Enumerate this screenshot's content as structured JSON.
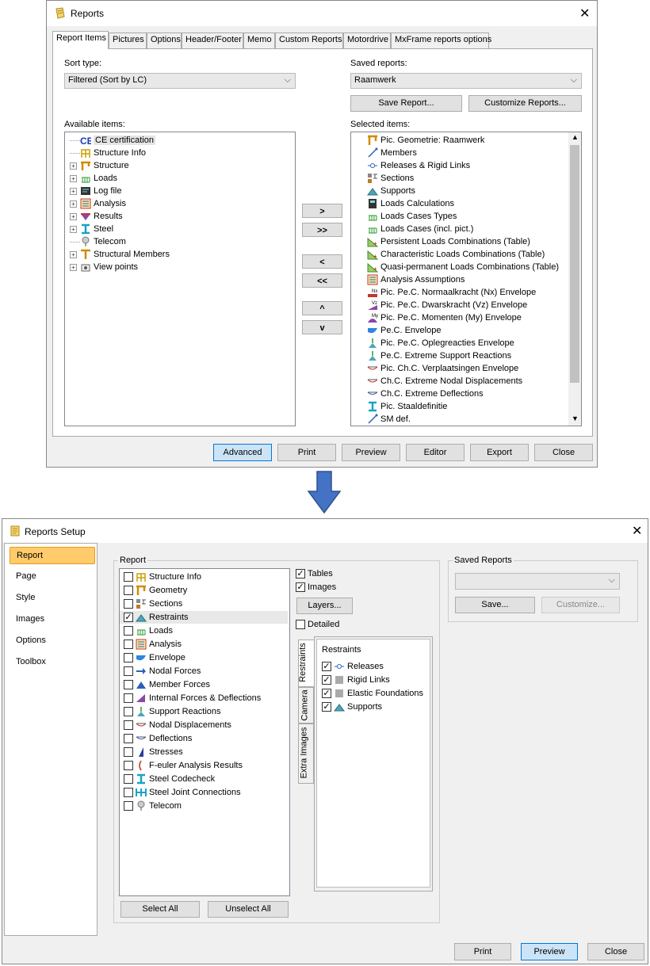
{
  "reports_dialog": {
    "title": "Reports",
    "tabs": [
      "Report Items",
      "Pictures",
      "Options",
      "Header/Footer",
      "Memo",
      "Custom Reports",
      "Motordrive",
      "MxFrame reports options"
    ],
    "sort_type_label": "Sort type:",
    "sort_type_value": "Filtered (Sort by LC)",
    "saved_reports_label": "Saved reports:",
    "saved_reports_value": "Raamwerk",
    "save_report_label": "Save Report...",
    "customize_reports_label": "Customize Reports...",
    "available_label": "Available items:",
    "available_items": [
      {
        "label": "CE certification",
        "icon": "ce-icon",
        "expandable": false,
        "selected": true
      },
      {
        "label": "Structure Info",
        "icon": "structure-info-icon",
        "expandable": false
      },
      {
        "label": "Structure",
        "icon": "structure-icon",
        "expandable": true
      },
      {
        "label": "Loads",
        "icon": "loads-icon",
        "expandable": true
      },
      {
        "label": "Log file",
        "icon": "log-file-icon",
        "expandable": true
      },
      {
        "label": "Analysis",
        "icon": "analysis-icon",
        "expandable": true
      },
      {
        "label": "Results",
        "icon": "results-icon",
        "expandable": true
      },
      {
        "label": "Steel",
        "icon": "steel-icon",
        "expandable": true
      },
      {
        "label": "Telecom",
        "icon": "telecom-icon",
        "expandable": false
      },
      {
        "label": "Structural Members",
        "icon": "structural-members-icon",
        "expandable": true
      },
      {
        "label": "View points",
        "icon": "view-points-icon",
        "expandable": true
      }
    ],
    "move_buttons": [
      ">",
      ">>",
      "<",
      "<<",
      "^",
      "v"
    ],
    "selected_label": "Selected items:",
    "selected_items": [
      {
        "label": "Pic. Geometrie: Raamwerk",
        "icon": "geometry-icon"
      },
      {
        "label": "Members",
        "icon": "members-icon"
      },
      {
        "label": "Releases & Rigid Links",
        "icon": "releases-icon"
      },
      {
        "label": "Sections",
        "icon": "sections-icon"
      },
      {
        "label": "Supports",
        "icon": "supports-icon"
      },
      {
        "label": "Loads Calculations",
        "icon": "loads-calculations-icon"
      },
      {
        "label": "Loads Cases Types",
        "icon": "load-cases-icon"
      },
      {
        "label": "Loads Cases (incl. pict.)",
        "icon": "load-cases-icon"
      },
      {
        "label": "Persistent Loads Combinations (Table)",
        "icon": "combination-icon"
      },
      {
        "label": "Characteristic Loads Combinations (Table)",
        "icon": "combination-icon"
      },
      {
        "label": "Quasi-permanent Loads Combinations (Table)",
        "icon": "combination-icon"
      },
      {
        "label": "Analysis Assumptions",
        "icon": "analysis-icon"
      },
      {
        "label": "Pic. Pe.C. Normaalkracht (Nx) Envelope",
        "icon": "nx-icon"
      },
      {
        "label": "Pic. Pe.C. Dwarskracht (Vz) Envelope",
        "icon": "vz-icon"
      },
      {
        "label": "Pic. Pe.C. Momenten (My) Envelope",
        "icon": "my-icon"
      },
      {
        "label": "Pe.C. Envelope",
        "icon": "envelope-icon"
      },
      {
        "label": "Pic. Pe.C. Oplegreacties Envelope",
        "icon": "support-reactions-icon"
      },
      {
        "label": "Pe.C. Extreme Support Reactions",
        "icon": "support-reactions-icon"
      },
      {
        "label": "Pic. Ch.C. Verplaatsingen Envelope",
        "icon": "displacement-icon"
      },
      {
        "label": "Ch.C. Extreme Nodal Displacements",
        "icon": "displacement-icon"
      },
      {
        "label": "Ch.C. Extreme Deflections",
        "icon": "deflection-icon"
      },
      {
        "label": "Pic. Staaldefinitie",
        "icon": "steel-icon"
      },
      {
        "label": "SM def.",
        "icon": "members-icon"
      }
    ],
    "footer_buttons": [
      "Advanced",
      "Print",
      "Preview",
      "Editor",
      "Export",
      "Close"
    ]
  },
  "setup_dialog": {
    "title": "Reports Setup",
    "nav": [
      "Report",
      "Page",
      "Style",
      "Images",
      "Options",
      "Toolbox"
    ],
    "report_group_label": "Report",
    "report_items": [
      {
        "label": "Structure Info",
        "checked": false
      },
      {
        "label": "Geometry",
        "checked": false
      },
      {
        "label": "Sections",
        "checked": false
      },
      {
        "label": "Restraints",
        "checked": true
      },
      {
        "label": "Loads",
        "checked": false
      },
      {
        "label": "Analysis",
        "checked": false
      },
      {
        "label": "Envelope",
        "checked": false
      },
      {
        "label": "Nodal Forces",
        "checked": false
      },
      {
        "label": "Member Forces",
        "checked": false
      },
      {
        "label": "Internal Forces & Deflections",
        "checked": false
      },
      {
        "label": "Support Reactions",
        "checked": false
      },
      {
        "label": "Nodal Displacements",
        "checked": false
      },
      {
        "label": "Deflections",
        "checked": false
      },
      {
        "label": "Stresses",
        "checked": false
      },
      {
        "label": "F-euler Analysis Results",
        "checked": false
      },
      {
        "label": "Steel Codecheck",
        "checked": false
      },
      {
        "label": "Steel Joint Connections",
        "checked": false
      },
      {
        "label": "Telecom",
        "checked": false
      }
    ],
    "tables_label": "Tables",
    "images_label": "Images",
    "layers_label": "Layers...",
    "detailed_label": "Detailed",
    "side_tabs": [
      "Restraints",
      "Camera",
      "Extra Images"
    ],
    "restraints_title": "Restraints",
    "restraint_items": [
      {
        "label": "Releases",
        "checked": true
      },
      {
        "label": "Rigid Links",
        "checked": true
      },
      {
        "label": "Elastic Foundations",
        "checked": true
      },
      {
        "label": "Supports",
        "checked": true
      }
    ],
    "select_all_label": "Select All",
    "unselect_all_label": "Unselect All",
    "saved_reports_label": "Saved Reports",
    "saved_reports_value": "",
    "save_label": "Save...",
    "customize_label": "Customize...",
    "footer_buttons": [
      "Print",
      "Preview",
      "Close"
    ]
  },
  "colors": {
    "accent": "#0078d7",
    "nav_selected": "#ffcb6b",
    "arrow": "#4472c4"
  }
}
